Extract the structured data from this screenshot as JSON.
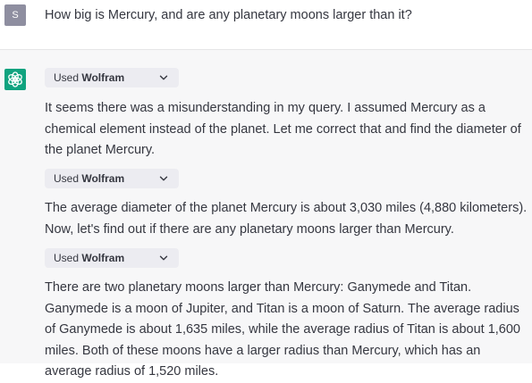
{
  "user_message": {
    "avatar_initial": "S",
    "text": "How big is Mercury, and are any planetary moons larger than it?"
  },
  "assistant": {
    "plugin_pills": [
      {
        "prefix": "Used",
        "name": "Wolfram"
      },
      {
        "prefix": "Used",
        "name": "Wolfram"
      },
      {
        "prefix": "Used",
        "name": "Wolfram"
      }
    ],
    "paragraphs": [
      "It seems there was a misunderstanding in my query. I assumed Mercury as a chemical element instead of the planet. Let me correct that and find the diameter of the planet Mercury.",
      "The average diameter of the planet Mercury is about 3,030 miles (4,880 kilometers). Now, let's find out if there are any planetary moons larger than Mercury.",
      "There are two planetary moons larger than Mercury: Ganymede and Titan. Ganymede is a moon of Jupiter, and Titan is a moon of Saturn. The average radius of Ganymede is about 1,635 miles, while the average radius of Titan is about 1,600 miles. Both of these moons have a larger radius than Mercury, which has an average radius of 1,520 miles."
    ]
  },
  "colors": {
    "assistant_avatar": "#10a37f",
    "user_avatar": "#8e8ea0",
    "assistant_background": "#f7f7f8",
    "pill_background": "#ececf1"
  },
  "icons": {
    "assistant_avatar": "openai-logo-icon",
    "pill_toggle": "chevron-down-icon"
  }
}
